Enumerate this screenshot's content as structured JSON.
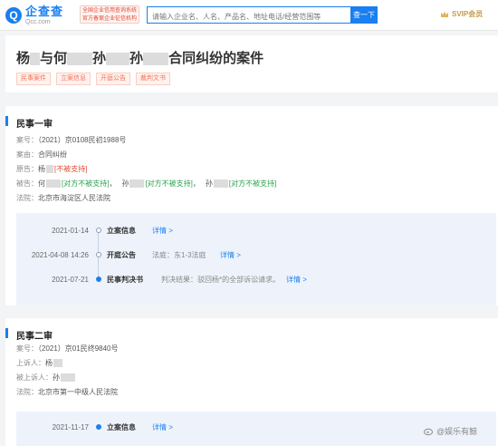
{
  "header": {
    "logo_icon": "Q",
    "logo_name": "企查查",
    "logo_url": "Qcc.com",
    "gov_badge_line1": "全国企业信用查询系统",
    "gov_badge_line2": "官方备案企业征信机构",
    "search_placeholder": "请输入企业名、人名、产品名、地址电话/经营范围等",
    "search_button": "查一下",
    "vip_label": "SVIP会员"
  },
  "case": {
    "title_parts": [
      "杨",
      "与何",
      "孙",
      "孙",
      "合同纠纷的案件"
    ],
    "tags": [
      "民事案件",
      "立案信息",
      "开庭公告",
      "裁判文书"
    ]
  },
  "first_instance": {
    "heading": "民事一审",
    "case_no_label": "案号：",
    "case_no": "（2021）京0108民初1988号",
    "cause_label": "案由：",
    "cause": "合同纠纷",
    "plaintiff_label": "原告：",
    "plaintiff_name": "杨",
    "plaintiff_note": "[不被支持]",
    "defendant_label": "被告：",
    "defendants": [
      {
        "name": "何",
        "note": "[对方不被支持]"
      },
      {
        "name": "孙",
        "note": "[对方不被支持]"
      },
      {
        "name": "孙",
        "note": "[对方不被支持]"
      }
    ],
    "court_label": "法院：",
    "court": "北京市海淀区人民法院",
    "timeline": [
      {
        "date": "2021-01-14",
        "event": "立案信息",
        "detail": "",
        "link": "详情 >"
      },
      {
        "date": "2021-04-08 14:26",
        "event": "开庭公告",
        "detail": "法庭：东1-3法庭",
        "link": "详情 >"
      },
      {
        "date": "2021-07-21",
        "event": "民事判决书",
        "detail": "判决结果：驳回杨*的全部诉讼请求。",
        "link": "详情 >"
      }
    ]
  },
  "second_instance": {
    "heading": "民事二审",
    "case_no_label": "案号：",
    "case_no": "（2021）京01民终9840号",
    "appellant_label": "上诉人：",
    "appellant": "杨",
    "appellee_label": "被上诉人：",
    "appellee": "孙",
    "court_label": "法院：",
    "court": "北京市第一中级人民法院",
    "timeline": [
      {
        "date": "2021-11-17",
        "event": "立案信息",
        "link": "详情 >"
      }
    ]
  },
  "watermark": "@娱乐有鲸",
  "colors": {
    "accent": "#1a7ff0",
    "warn_red": "#e04a33",
    "warn_green": "#2ba24c",
    "vip_gold": "#c69c4a"
  }
}
